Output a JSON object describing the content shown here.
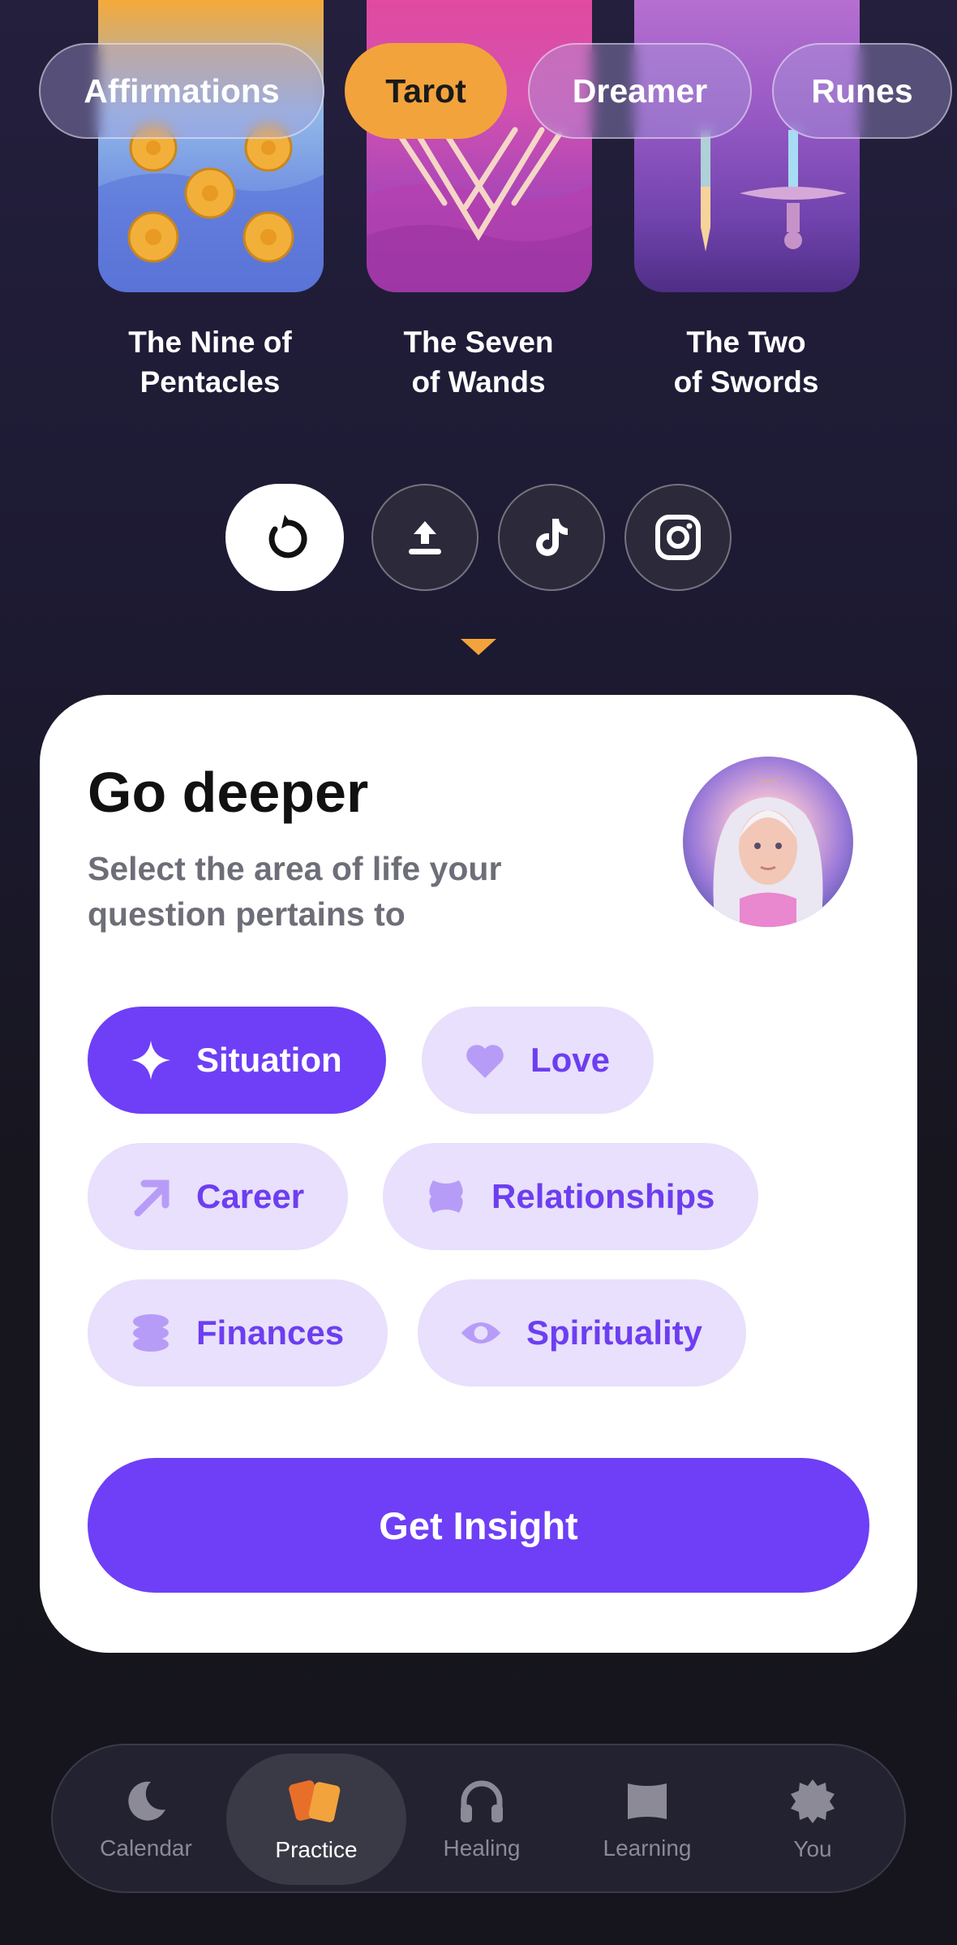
{
  "chips": [
    {
      "label": "Affirmations",
      "active": false
    },
    {
      "label": "Tarot",
      "active": true
    },
    {
      "label": "Dreamer",
      "active": false
    },
    {
      "label": "Runes",
      "active": false
    }
  ],
  "cards": [
    {
      "title_line1": "The Nine of",
      "title_line2": "Pentacles"
    },
    {
      "title_line1": "The Seven",
      "title_line2": "of Wands"
    },
    {
      "title_line1": "The Two",
      "title_line2": "of Swords"
    }
  ],
  "share": {
    "icons": [
      "refresh-icon",
      "upload-icon",
      "tiktok-icon",
      "instagram-icon"
    ]
  },
  "sheet": {
    "title": "Go deeper",
    "subtitle": "Select the area of life your question pertains to",
    "areas": [
      {
        "label": "Situation",
        "icon": "sparkle-icon",
        "selected": true
      },
      {
        "label": "Love",
        "icon": "heart-icon",
        "selected": false
      },
      {
        "label": "Career",
        "icon": "arrow-up-right-icon",
        "selected": false
      },
      {
        "label": "Relationships",
        "icon": "relationships-icon",
        "selected": false
      },
      {
        "label": "Finances",
        "icon": "coins-icon",
        "selected": false
      },
      {
        "label": "Spirituality",
        "icon": "eye-icon",
        "selected": false
      }
    ],
    "cta": "Get Insight"
  },
  "nav": {
    "items": [
      {
        "label": "Calendar",
        "icon": "moon-icon",
        "active": false
      },
      {
        "label": "Practice",
        "icon": "cards-icon",
        "active": true
      },
      {
        "label": "Healing",
        "icon": "headphones-icon",
        "active": false
      },
      {
        "label": "Learning",
        "icon": "book-icon",
        "active": false
      },
      {
        "label": "You",
        "icon": "gear-icon",
        "active": false
      }
    ]
  },
  "colors": {
    "accent": "#6e3ff6",
    "chip_active": "#f2a33c",
    "pill_bg": "#e8e0fc"
  }
}
